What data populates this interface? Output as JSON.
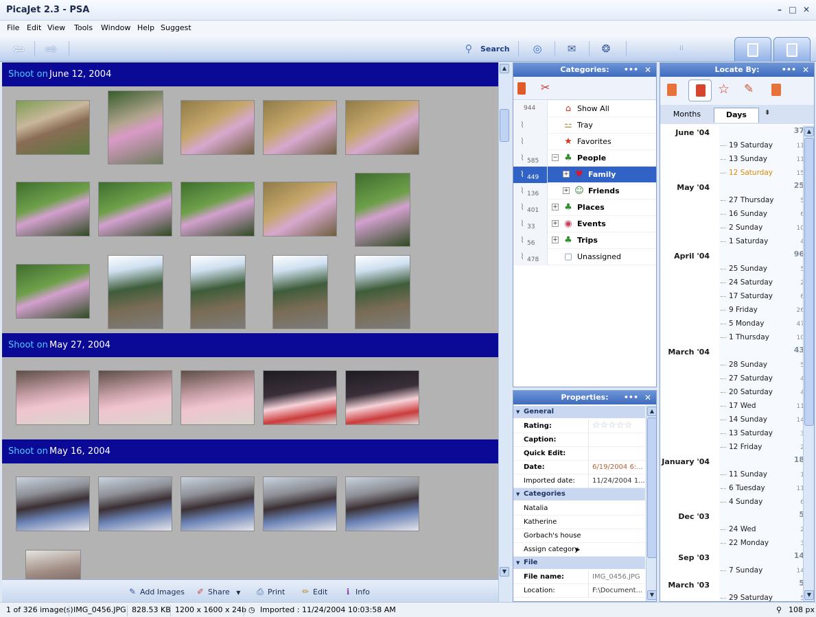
{
  "window": {
    "title": "PicaJet 2.3 - PSA"
  },
  "menu": [
    "File",
    "Edit",
    "View",
    "Tools",
    "Window",
    "Help",
    "Suggest"
  ],
  "toolbar": {
    "search_label": "Search"
  },
  "groups": [
    {
      "shoot_label": "Shoot on",
      "date": "June 12, 2004"
    },
    {
      "shoot_label": "Shoot on",
      "date": "May 27, 2004"
    },
    {
      "shoot_label": "Shoot on",
      "date": "May 16, 2004"
    }
  ],
  "actions": {
    "add": "Add Images",
    "share": "Share",
    "print": "Print",
    "edit": "Edit",
    "info": "Info"
  },
  "categories": {
    "title": "Categories:",
    "rows": [
      {
        "count": "944",
        "label": "Show All",
        "icon": "house-icon"
      },
      {
        "count": "",
        "label": "Tray",
        "icon": "bone-icon"
      },
      {
        "count": "",
        "label": "Favorites",
        "icon": "star-icon"
      },
      {
        "count": "585",
        "label": "People",
        "icon": "palm-icon",
        "expander": "−"
      },
      {
        "count": "449",
        "label": "Family",
        "icon": "heart-icon",
        "expander": "+"
      },
      {
        "count": "136",
        "label": "Friends",
        "icon": "friends-icon",
        "expander": "+"
      },
      {
        "count": "401",
        "label": "Places",
        "icon": "palm-icon",
        "expander": "+"
      },
      {
        "count": "33",
        "label": "Events",
        "icon": "cake-icon",
        "expander": "+"
      },
      {
        "count": "56",
        "label": "Trips",
        "icon": "palm-icon",
        "expander": "+"
      },
      {
        "count": "478",
        "label": "Unassigned",
        "icon": "box-icon"
      }
    ]
  },
  "properties": {
    "title": "Properties:",
    "general": "General",
    "rating": "Rating:",
    "caption": "Caption:",
    "quick_edit": "Quick Edit:",
    "date_label": "Date:",
    "date_value": "6/19/2004 6:...",
    "imported_label": "Imported date:",
    "imported_value": "11/24/2004 1...",
    "categories_sec": "Categories",
    "cat_items": [
      "Natalia",
      "Katherine",
      "Gorbach's house",
      "Assign category"
    ],
    "file_sec": "File",
    "filename_label": "File name:",
    "filename_value": "IMG_0456.JPG",
    "location_label": "Location:",
    "location_value": "F:\\Document..."
  },
  "locate": {
    "title": "Locate By:",
    "tab_months": "Months",
    "tab_days": "Days",
    "entries": [
      {
        "type": "month",
        "label": "June '04",
        "total": "37"
      },
      {
        "type": "day",
        "label": "19 Saturday",
        "count": "11"
      },
      {
        "type": "day",
        "label": "13 Sunday",
        "count": "11"
      },
      {
        "type": "day",
        "label": "12 Saturday",
        "count": "15",
        "highlight": true
      },
      {
        "type": "month",
        "label": "May '04",
        "total": "25"
      },
      {
        "type": "day",
        "label": "27 Thursday",
        "count": "5"
      },
      {
        "type": "day",
        "label": "16 Sunday",
        "count": "6"
      },
      {
        "type": "day",
        "label": "2 Sunday",
        "count": "10"
      },
      {
        "type": "day",
        "label": "1 Saturday",
        "count": "4"
      },
      {
        "type": "month",
        "label": "April '04",
        "total": "96"
      },
      {
        "type": "day",
        "label": "25 Sunday",
        "count": "5"
      },
      {
        "type": "day",
        "label": "24 Saturday",
        "count": "2"
      },
      {
        "type": "day",
        "label": "17 Saturday",
        "count": "6"
      },
      {
        "type": "day",
        "label": "9 Friday",
        "count": "26"
      },
      {
        "type": "day",
        "label": "5 Monday",
        "count": "47"
      },
      {
        "type": "day",
        "label": "1 Thursday",
        "count": "10"
      },
      {
        "type": "month",
        "label": "March '04",
        "total": "43"
      },
      {
        "type": "day",
        "label": "28 Sunday",
        "count": "5"
      },
      {
        "type": "day",
        "label": "27 Saturday",
        "count": "4"
      },
      {
        "type": "day",
        "label": "20 Saturday",
        "count": "4"
      },
      {
        "type": "day",
        "label": "17 Wed",
        "count": "11"
      },
      {
        "type": "day",
        "label": "14 Sunday",
        "count": "14"
      },
      {
        "type": "day",
        "label": "13 Saturday",
        "count": "3"
      },
      {
        "type": "day",
        "label": "12 Friday",
        "count": "2"
      },
      {
        "type": "month",
        "label": "January '04",
        "total": "18"
      },
      {
        "type": "day",
        "label": "11 Sunday",
        "count": "1"
      },
      {
        "type": "day",
        "label": "6 Tuesday",
        "count": "11"
      },
      {
        "type": "day",
        "label": "4 Sunday",
        "count": "6"
      },
      {
        "type": "month",
        "label": "Dec '03",
        "total": "5"
      },
      {
        "type": "day",
        "label": "24 Wed",
        "count": "2"
      },
      {
        "type": "day",
        "label": "22 Monday",
        "count": "3"
      },
      {
        "type": "month",
        "label": "Sep '03",
        "total": "14"
      },
      {
        "type": "day",
        "label": "7 Sunday",
        "count": "14"
      },
      {
        "type": "month",
        "label": "March '03",
        "total": "5"
      },
      {
        "type": "day",
        "label": "29 Saturday",
        "count": "5"
      }
    ]
  },
  "status": {
    "count": "1 of 326 image(s)",
    "filename": "IMG_0456.JPG",
    "size": "828.53 KB",
    "dims": "1200 x 1600 x 24b",
    "imported": "Imported : 11/24/2004 10:03:58 AM",
    "zoom": "108 px"
  }
}
